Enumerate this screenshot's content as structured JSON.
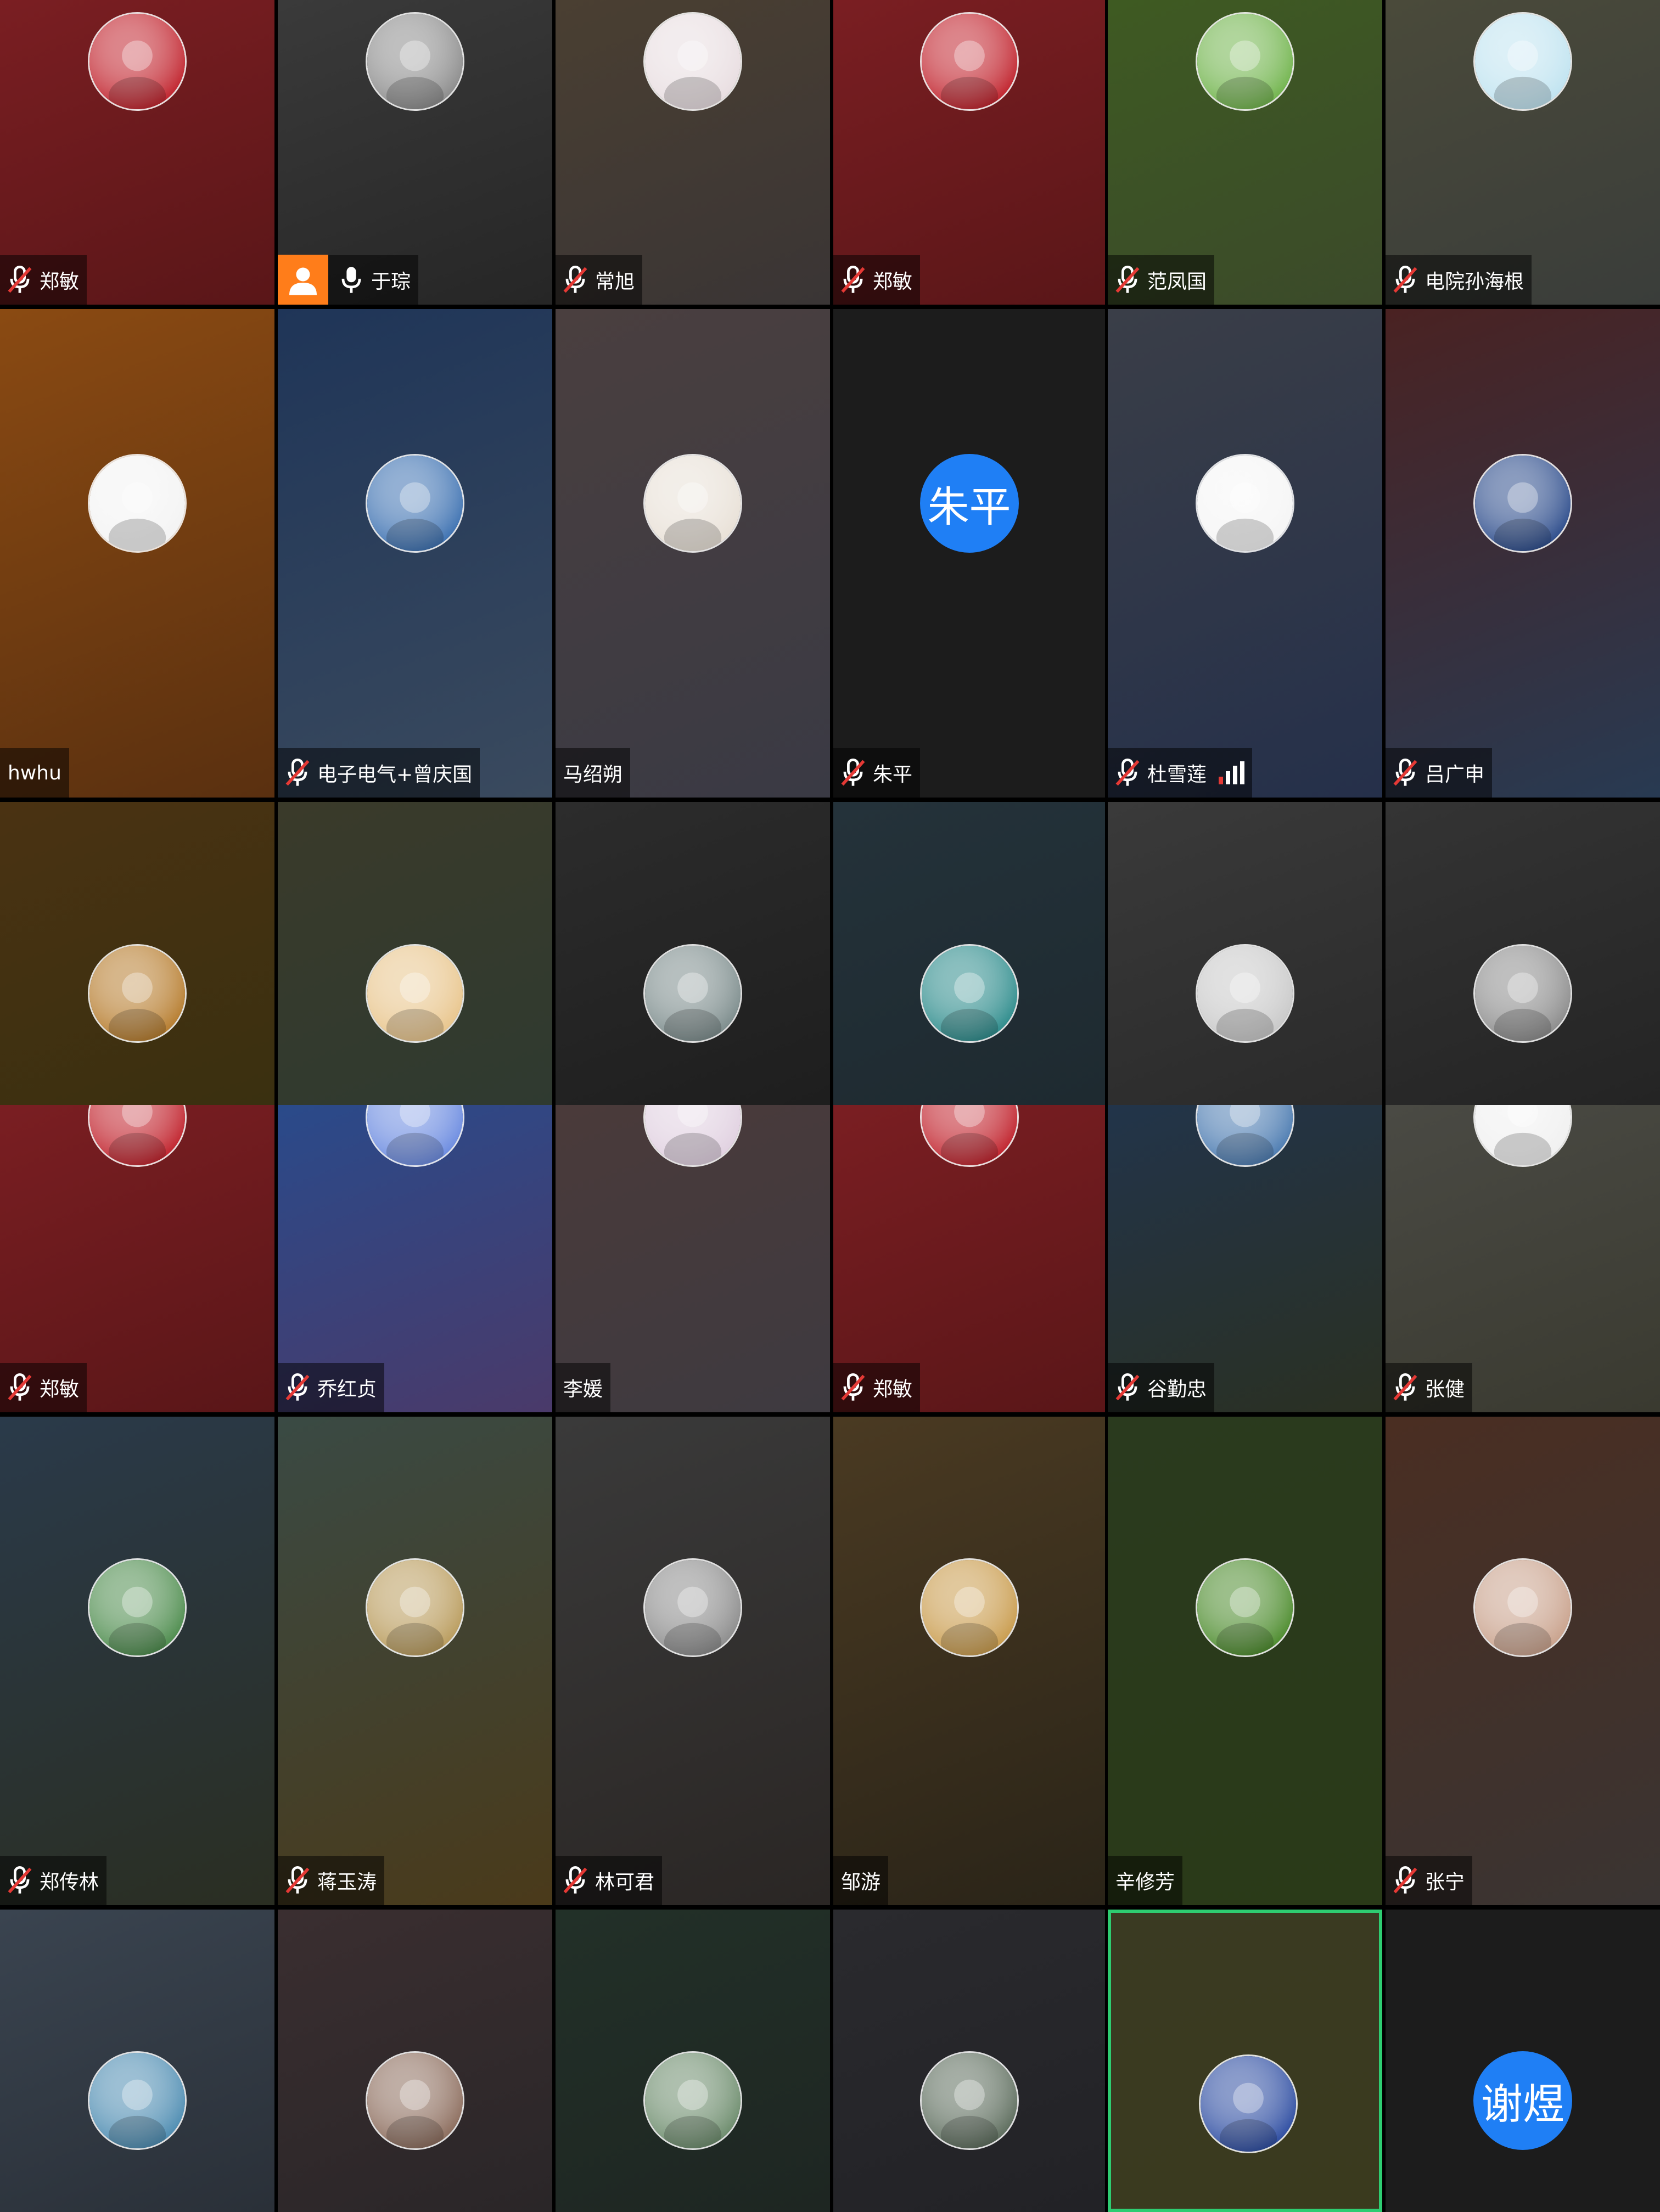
{
  "participants": [
    {
      "name": "郑敏",
      "mic": "muted",
      "avatar": "tiger-new-year-avatar-icon",
      "avatar_bg": "#c0202a",
      "bg": [
        "#7a1e22",
        "#5a1618"
      ]
    },
    {
      "name": "于琮",
      "mic": "on",
      "host": true,
      "avatar": "misty-mountain-avatar-icon",
      "avatar_bg": "#8a8a8a",
      "bg": [
        "#3a3a3a",
        "#262626"
      ]
    },
    {
      "name": "常旭",
      "mic": "muted",
      "avatar": "flower-bouquet-avatar-icon",
      "avatar_bg": "#e8dde0",
      "bg": [
        "#4a3f32",
        "#3a3535"
      ]
    },
    {
      "name": "郑敏",
      "mic": "muted",
      "avatar": "tiger-new-year-avatar-icon",
      "avatar_bg": "#c0202a",
      "bg": [
        "#7a1e22",
        "#5a1618"
      ]
    },
    {
      "name": "范凤国",
      "mic": "muted",
      "avatar": "green-leaf-avatar-icon",
      "avatar_bg": "#6fb34a",
      "bg": [
        "#3e5a22",
        "#3b4a2a"
      ]
    },
    {
      "name": "电院孙海根",
      "mic": "muted",
      "avatar": "minions-avatar-icon",
      "avatar_bg": "#bfe3f0",
      "bg": [
        "#4a4a3a",
        "#3a3d3a"
      ]
    },
    {
      "name": "hwhu",
      "mic": "none",
      "avatar": "cartoon-tiger-avatar-icon",
      "avatar_bg": "#f3f3f3",
      "bg": [
        "#8a4a12",
        "#5a3010"
      ]
    },
    {
      "name": "电子电气+曾庆国",
      "mic": "muted",
      "avatar": "blue-sky-light-avatar-icon",
      "avatar_bg": "#3a6fb0",
      "bg": [
        "#1f3558",
        "#3a4a5e"
      ]
    },
    {
      "name": "马绍朔",
      "mic": "none",
      "avatar": "anime-boy-avatar-icon",
      "avatar_bg": "#e8e0d6",
      "bg": [
        "#4a3f3f",
        "#3a3a44"
      ]
    },
    {
      "name": "朱平",
      "mic": "muted",
      "avatar_text": "朱平",
      "bg": [
        "#1c1c1c",
        "#1c1c1c"
      ]
    },
    {
      "name": "杜雪莲",
      "mic": "muted",
      "signal": true,
      "avatar": "white-rabbit-avatar-icon",
      "avatar_bg": "#f5f5f5",
      "bg": [
        "#3a3e48",
        "#25304a"
      ]
    },
    {
      "name": "吕广申",
      "mic": "muted",
      "avatar": "anime-warrior-avatar-icon",
      "avatar_bg": "#2a4a8a",
      "bg": [
        "#4a2222",
        "#283a52"
      ]
    },
    {
      "name": "",
      "mic": "none",
      "avatar": "golden-wheat-avatar-icon",
      "avatar_bg": "#b57a2a",
      "bg": [
        "#4a3212",
        "#3a3010"
      ],
      "cut": true
    },
    {
      "name": "",
      "mic": "none",
      "avatar": "doraemon-avatar-icon",
      "avatar_bg": "#e8c48a",
      "bg": [
        "#3a3a2a",
        "#2f3a30"
      ],
      "cut": true
    },
    {
      "name": "",
      "mic": "none",
      "avatar": "mountain-peaks-avatar-icon",
      "avatar_bg": "#7a8a8a",
      "bg": [
        "#2c2c2c",
        "#1e1e1e"
      ],
      "cut": true
    },
    {
      "name": "",
      "mic": "none",
      "avatar": "lake-girl-avatar-icon",
      "avatar_bg": "#2a8a8a",
      "bg": [
        "#24323a",
        "#1e2a30"
      ],
      "cut": true
    },
    {
      "name": "",
      "mic": "none",
      "avatar": "stone-sculpture-avatar-icon",
      "avatar_bg": "#c8c8c8",
      "bg": [
        "#3a3a3a",
        "#2a2a2a"
      ],
      "cut": true
    },
    {
      "name": "",
      "mic": "none",
      "avatar": "runner-sunset-avatar-icon",
      "avatar_bg": "#8a8a8a",
      "bg": [
        "#343434",
        "#242424"
      ],
      "cut": true
    },
    {
      "name": "郑敏",
      "mic": "muted",
      "avatar": "tiger-new-year-avatar-icon",
      "avatar_bg": "#c0202a",
      "bg": [
        "#7a1e22",
        "#5a1618"
      ]
    },
    {
      "name": "乔红贞",
      "mic": "muted",
      "avatar": "abstract-wave-avatar-icon",
      "avatar_bg": "#6a8ae0",
      "bg": [
        "#2a4a8a",
        "#4a3a6a"
      ]
    },
    {
      "name": "李媛",
      "mic": "none",
      "avatar": "anime-girl-avatar-icon",
      "avatar_bg": "#e0d0e0",
      "bg": [
        "#4a3a3a",
        "#3e3a40"
      ]
    },
    {
      "name": "郑敏",
      "mic": "muted",
      "avatar": "tiger-new-year-avatar-icon",
      "avatar_bg": "#c0202a",
      "bg": [
        "#7a1e22",
        "#5a1618"
      ]
    },
    {
      "name": "谷勤忠",
      "mic": "muted",
      "avatar": "radio-telescope-avatar-icon",
      "avatar_bg": "#4a7ab0",
      "bg": [
        "#22344a",
        "#2a3022"
      ]
    },
    {
      "name": "张健",
      "mic": "muted",
      "avatar": "meerkat-avatar-icon",
      "avatar_bg": "#f0f0f0",
      "bg": [
        "#4a4a44",
        "#3a3a30"
      ]
    },
    {
      "name": "郑传林",
      "mic": "muted",
      "avatar": "garden-path-avatar-icon",
      "avatar_bg": "#4a8a4a",
      "bg": [
        "#2a3a4a",
        "#2a2e22"
      ]
    },
    {
      "name": "蒋玉涛",
      "mic": "muted",
      "avatar": "desert-road-avatar-icon",
      "avatar_bg": "#b89a5a",
      "bg": [
        "#3a4a44",
        "#4a3a1a"
      ]
    },
    {
      "name": "林可君",
      "mic": "muted",
      "avatar": "child-standing-avatar-icon",
      "avatar_bg": "#8a8a8a",
      "bg": [
        "#3a3a3a",
        "#2a2624"
      ]
    },
    {
      "name": "邹游",
      "mic": "none",
      "avatar": "parent-child-sunset-avatar-icon",
      "avatar_bg": "#c89a4a",
      "bg": [
        "#4a3a22",
        "#2a2418"
      ]
    },
    {
      "name": "辛修芳",
      "mic": "none",
      "avatar": "green-leaf-snail-avatar-icon",
      "avatar_bg": "#4a8a2a",
      "bg": [
        "#2a3a1e",
        "#2a3a18"
      ]
    },
    {
      "name": "张宁",
      "mic": "muted",
      "avatar": "child-winter-avatar-icon",
      "avatar_bg": "#c8a08a",
      "bg": [
        "#4a2e22",
        "#3a3432"
      ]
    },
    {
      "name": "",
      "mic": "none",
      "avatar": "seaside-cliff-avatar-icon",
      "avatar_bg": "#4a8ab0",
      "bg": [
        "#3a4450",
        "#2a3038"
      ],
      "cut": true
    },
    {
      "name": "",
      "mic": "none",
      "avatar": "baby-cap-avatar-icon",
      "avatar_bg": "#8a6a5a",
      "bg": [
        "#3a2e30",
        "#2a2628"
      ],
      "cut": true
    },
    {
      "name": "",
      "mic": "none",
      "avatar": "toddler-outdoor-avatar-icon",
      "avatar_bg": "#6a8a6a",
      "bg": [
        "#223028",
        "#1e2622"
      ],
      "cut": true
    },
    {
      "name": "",
      "mic": "none",
      "avatar": "town-reflection-avatar-icon",
      "avatar_bg": "#5a6a5a",
      "bg": [
        "#2a2a2e",
        "#222226"
      ],
      "cut": true
    },
    {
      "name": "",
      "mic": "none",
      "avatar": "lion-cartoon-avatar-icon",
      "avatar_bg": "#2a4aa0",
      "bg": [
        "#3a3a22",
        "#3a3a1e"
      ],
      "cut": true,
      "active": true
    },
    {
      "name": "",
      "mic": "none",
      "avatar_text": "谢煜",
      "bg": [
        "#1c1c1c",
        "#1c1c1c"
      ],
      "cut": true
    }
  ],
  "colors": {
    "avatar_text_bg": "#1f7ff5",
    "host_badge": "#ff7d1a",
    "active_border": "#2ecc71"
  }
}
